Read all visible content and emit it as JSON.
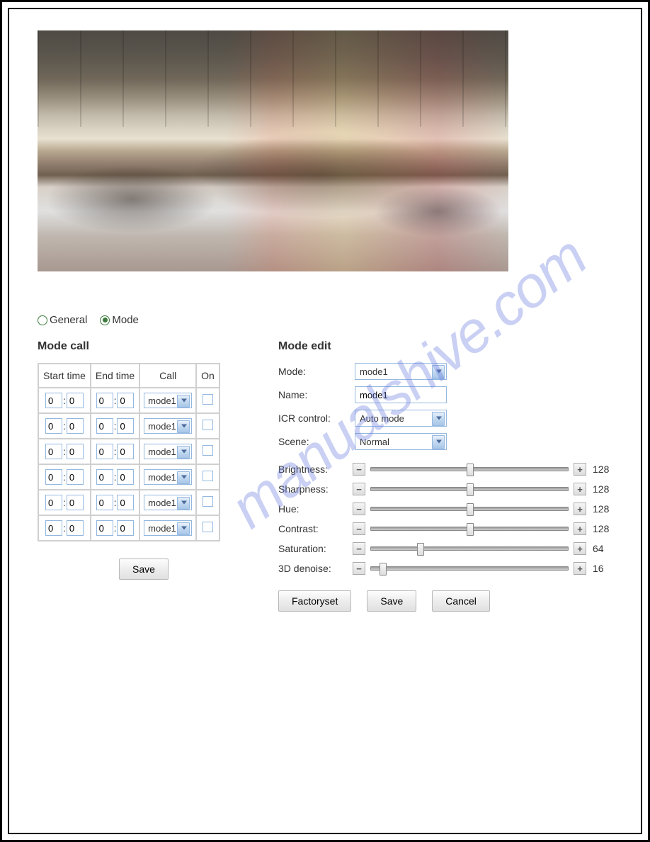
{
  "watermark": "manualshive.com",
  "radios": {
    "general": "General",
    "mode": "Mode",
    "selected": "mode"
  },
  "modeCall": {
    "title": "Mode call",
    "headers": {
      "start": "Start time",
      "end": "End time",
      "call": "Call",
      "on": "On"
    },
    "rows": [
      {
        "sh": "0",
        "sm": "0",
        "eh": "0",
        "em": "0",
        "call": "mode1",
        "on": false
      },
      {
        "sh": "0",
        "sm": "0",
        "eh": "0",
        "em": "0",
        "call": "mode1",
        "on": false
      },
      {
        "sh": "0",
        "sm": "0",
        "eh": "0",
        "em": "0",
        "call": "mode1",
        "on": false
      },
      {
        "sh": "0",
        "sm": "0",
        "eh": "0",
        "em": "0",
        "call": "mode1",
        "on": false
      },
      {
        "sh": "0",
        "sm": "0",
        "eh": "0",
        "em": "0",
        "call": "mode1",
        "on": false
      },
      {
        "sh": "0",
        "sm": "0",
        "eh": "0",
        "em": "0",
        "call": "mode1",
        "on": false
      }
    ],
    "saveLabel": "Save"
  },
  "modeEdit": {
    "title": "Mode edit",
    "fields": {
      "mode_label": "Mode:",
      "mode_value": "mode1",
      "name_label": "Name:",
      "name_value": "mode1",
      "icr_label": "ICR control:",
      "icr_value": "Auto mode",
      "scene_label": "Scene:",
      "scene_value": "Normal"
    },
    "sliders": [
      {
        "label": "Brightness:",
        "value": 128,
        "max": 255
      },
      {
        "label": "Sharpness:",
        "value": 128,
        "max": 255
      },
      {
        "label": "Hue:",
        "value": 128,
        "max": 255
      },
      {
        "label": "Contrast:",
        "value": 128,
        "max": 255
      },
      {
        "label": "Saturation:",
        "value": 64,
        "max": 255
      },
      {
        "label": "3D denoise:",
        "value": 16,
        "max": 255
      }
    ],
    "buttons": {
      "factory": "Factoryset",
      "save": "Save",
      "cancel": "Cancel"
    }
  }
}
